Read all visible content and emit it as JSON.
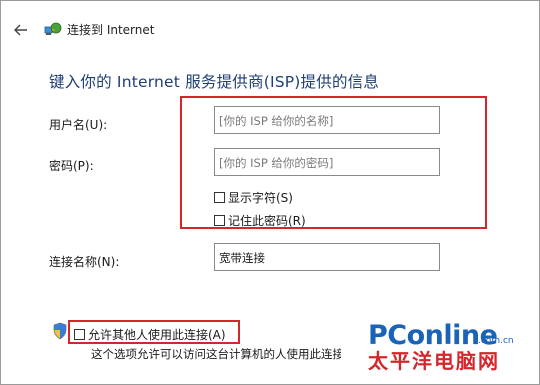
{
  "header": {
    "back_icon": "back-arrow-icon",
    "app_icon": "network-connection-icon",
    "title": "连接到 Internet"
  },
  "heading": "键入你的 Internet 服务提供商(ISP)提供的信息",
  "form": {
    "username_label": "用户名(U):",
    "username_placeholder": "[你的 ISP 给你的名称]",
    "password_label": "密码(P):",
    "password_placeholder": "[你的 ISP 给你的密码]",
    "show_chars_label": "显示字符(S)",
    "remember_pw_label": "记住此密码(R)",
    "conn_name_label": "连接名称(N):",
    "conn_name_value": "宽带连接",
    "allow_others_label": "允许其他人使用此连接(A)",
    "allow_others_note": "这个选项允许可以访问这台计算机的人使用此连接。"
  },
  "watermark": {
    "main": "PConline",
    "sub": ".com.cn",
    "cn": "太平洋电脑网"
  },
  "colors": {
    "heading": "#1e3f73",
    "highlight": "#d4262b",
    "watermark_blue": "#1b63b8"
  }
}
